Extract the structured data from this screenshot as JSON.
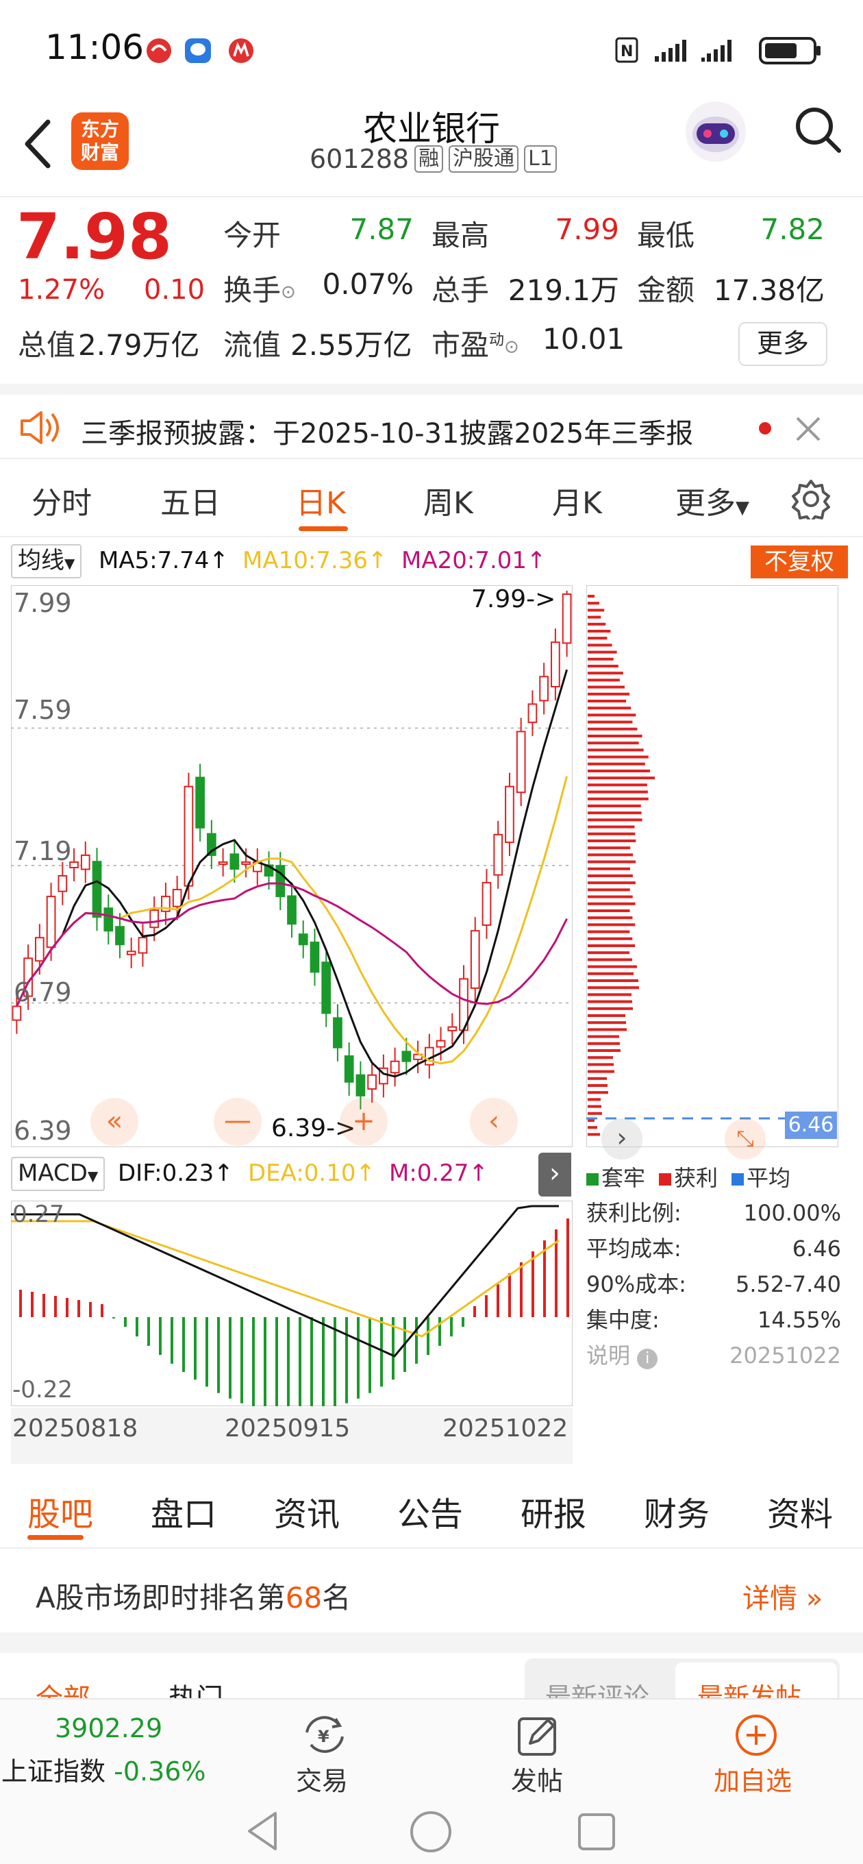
{
  "status": {
    "time": "11:06"
  },
  "header": {
    "logo_text": "东方财富",
    "title": "农业银行",
    "code": "601288",
    "tags": [
      "融",
      "沪股通",
      "L1"
    ]
  },
  "quote": {
    "price": "7.98",
    "change_pct": "1.27%",
    "change": "0.10",
    "open_label": "今开",
    "open": "7.87",
    "high_label": "最高",
    "high": "7.99",
    "low_label": "最低",
    "low": "7.82",
    "turnover_label": "换手",
    "turnover": "0.07%",
    "volume_label": "总手",
    "volume": "219.1万",
    "amount_label": "金额",
    "amount": "17.38亿",
    "mktcap_label": "总值",
    "mktcap": "2.79万亿",
    "float_label": "流值",
    "float": "2.55万亿",
    "pe_label": "市盈",
    "pe_sup": "动",
    "pe": "10.01",
    "more_button": "更多"
  },
  "notice": {
    "text": "三季报预披露：于2025-10-31披露2025年三季报"
  },
  "period_tabs": [
    "分时",
    "五日",
    "日K",
    "周K",
    "月K",
    "更多"
  ],
  "period_active": 2,
  "ma_bar": {
    "selector": "均线",
    "ma5": "MA5:7.74",
    "ma10": "MA10:7.36",
    "ma20": "MA20:7.01",
    "adjust": "不复权",
    "colors": {
      "ma5": "#111111",
      "ma10": "#f0c020",
      "ma20": "#c0107a"
    }
  },
  "kline": {
    "price_labels": [
      "7.99",
      "7.59",
      "7.19",
      "6.79",
      "6.39"
    ],
    "high_marker": "7.99->",
    "low_marker": "6.39->",
    "cost_marker": "6.46",
    "colors": {
      "up": "#e02020",
      "down": "#1a9a2a"
    }
  },
  "macd_bar": {
    "selector": "MACD",
    "dif": "DIF:0.23",
    "dea": "DEA:0.10",
    "m": "M:0.27"
  },
  "macd": {
    "top_label": "0.27",
    "bottom_label": "-0.22",
    "dates": [
      "20250818",
      "20250915",
      "20251022"
    ]
  },
  "chip": {
    "legend": [
      "套牢",
      "获利",
      "平均"
    ],
    "legend_colors": [
      "#1a9a2a",
      "#e02020",
      "#2a7ae0"
    ],
    "rows": [
      {
        "label": "获利比例:",
        "value": "100.00%"
      },
      {
        "label": "平均成本:",
        "value": "6.46"
      },
      {
        "label": "90%成本:",
        "value": "5.52-7.40"
      },
      {
        "label": "集中度:",
        "value": "14.55%"
      }
    ],
    "note_label": "说明",
    "note_value": "20251022"
  },
  "info_tabs": [
    "股吧",
    "盘口",
    "资讯",
    "公告",
    "研报",
    "财务",
    "资料"
  ],
  "info_active": 0,
  "rank": {
    "prefix": "A股市场即时排名第",
    "number": "68",
    "suffix": "名",
    "detail": "详情"
  },
  "filter": {
    "left": [
      "全部",
      "热门"
    ],
    "right": [
      "最新评论",
      "最新发帖"
    ]
  },
  "footer": {
    "index_value": "3902.29",
    "index_name": "上证指数",
    "index_change": "-0.36%",
    "trade": "交易",
    "post": "发帖",
    "add": "加自选"
  }
}
